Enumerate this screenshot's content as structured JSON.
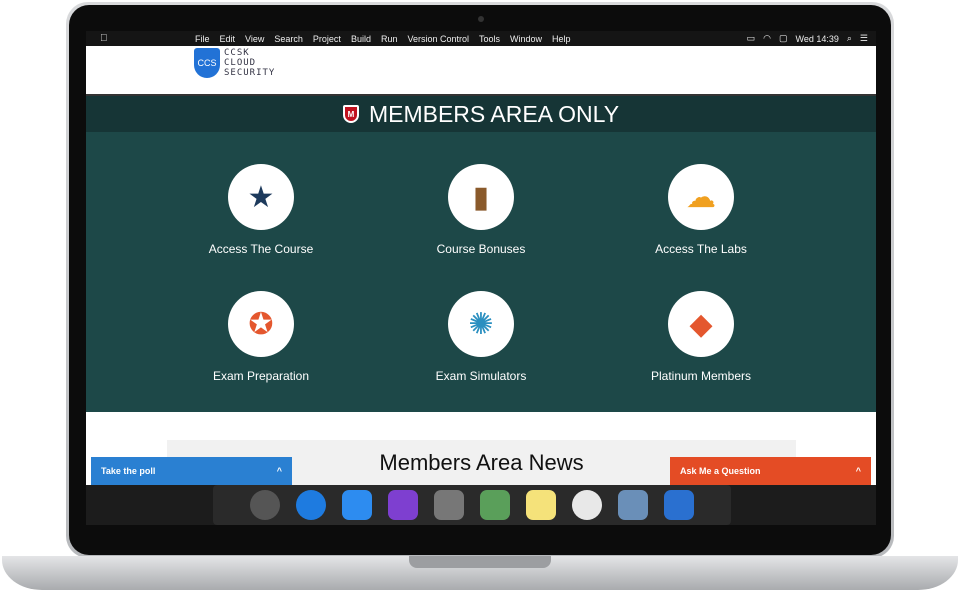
{
  "menubar": {
    "items": [
      "File",
      "Edit",
      "View",
      "Search",
      "Project",
      "Build",
      "Run",
      "Version Control",
      "Tools",
      "Window",
      "Help"
    ],
    "clock": "Wed 14:39"
  },
  "logo": {
    "badge": "CCS",
    "line1": "CCSK",
    "line2": "CLOUD",
    "line3": "SECURITY"
  },
  "banner": {
    "title": "MEMBERS AREA ONLY",
    "badge": "M"
  },
  "tiles": [
    {
      "label": "Access The Course",
      "icon": "browser-star-icon",
      "color": "#1d3a5c"
    },
    {
      "label": "Course Bonuses",
      "icon": "book-star-icon",
      "color": "#8a5a2b"
    },
    {
      "label": "Access The Labs",
      "icon": "cloud-arrows-icon",
      "color": "#f0a020"
    },
    {
      "label": "Exam Preparation",
      "icon": "award-ribbon-icon",
      "color": "#e4572e"
    },
    {
      "label": "Exam Simulators",
      "icon": "seal-badge-icon",
      "color": "#2a8fc0"
    },
    {
      "label": "Platinum Members",
      "icon": "diamond-icon",
      "color": "#e4572e"
    }
  ],
  "news": {
    "title": "Members Area News"
  },
  "poll": {
    "label": "Take the poll"
  },
  "ask": {
    "label": "Ask Me a Question"
  },
  "dock": [
    "Launchpad",
    "Safari",
    "Messages",
    "Visual Studio",
    "Calculator",
    "Maps",
    "Notes",
    "Photos",
    "Preview",
    "Xcode"
  ]
}
